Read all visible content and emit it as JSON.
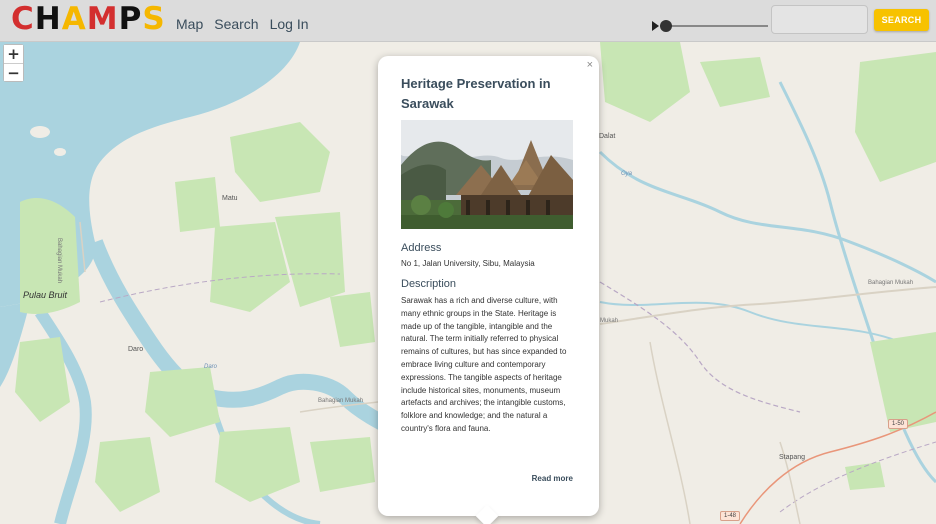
{
  "app": {
    "logo_letters": [
      {
        "char": "C",
        "color": "#d32f2f"
      },
      {
        "char": "H",
        "color": "#111111"
      },
      {
        "char": "A",
        "color": "#f5b700"
      },
      {
        "char": "M",
        "color": "#d32f2f"
      },
      {
        "char": "P",
        "color": "#111111"
      },
      {
        "char": "S",
        "color": "#f5b700"
      }
    ]
  },
  "nav": {
    "map": "Map",
    "search": "Search",
    "login": "Log In"
  },
  "toolbar": {
    "search_value": "",
    "search_button": "SEARCH",
    "slider_level": 0.0
  },
  "zoom": {
    "in": "+",
    "out": "−"
  },
  "map_labels": {
    "pulau_bruit": "Pulau Bruit",
    "matu": "Matu",
    "daro": "Daro",
    "dalat": "Dalat",
    "oya": "Oya",
    "bahagian_mukah_road_1": "Bahagian Mukah",
    "bahagian_mukah_road_2": "Bahagian Mukah",
    "bahagian_mukah_road_3": "Bahagian Mukah",
    "mukah_partial": "Mukah",
    "daro_river": "Daro",
    "stapang": "Stapang",
    "shield_1_50": "1-50",
    "shield_1_48": "1-48"
  },
  "popup": {
    "close": "×",
    "title": "Heritage Preservation in Sarawak",
    "address_heading": "Address",
    "address": "No 1, Jalan University, Sibu, Malaysia",
    "description_heading": "Description",
    "description": "Sarawak has a rich and diverse culture, with many ethnic groups in the State. Heritage is made up of the tangible, intangible and the natural. The term initially referred to physical remains of cultures, but has since expanded to embrace living culture and contemporary expressions. The tangible aspects of heritage include historical sites, monuments, museum artefacts and archives; the intangible customs, folklore and knowledge; and the natural a country's flora and fauna.",
    "read_more": "Read more"
  },
  "colors": {
    "water": "#aad3df",
    "forest": "#c8e6b4",
    "land": "#f0ede6",
    "accent": "#f7c200",
    "heading": "#3a4d5c"
  }
}
